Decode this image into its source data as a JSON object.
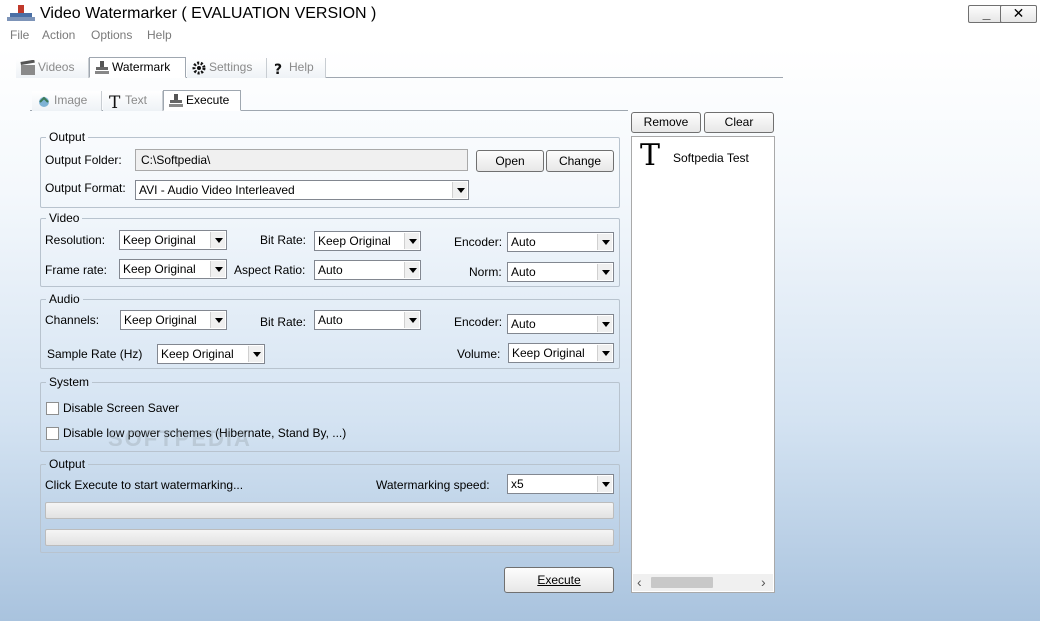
{
  "window": {
    "title": "Video Watermarker ( EVALUATION VERSION )",
    "minimize_glyph": "_",
    "close_glyph": "✕"
  },
  "menu": [
    "File",
    "Action",
    "Options",
    "Help"
  ],
  "main_tabs": [
    {
      "label": "Videos",
      "icon": "film-icon",
      "active": false
    },
    {
      "label": "Watermark",
      "icon": "stamp-icon",
      "active": true
    },
    {
      "label": "Settings",
      "icon": "gear-icon",
      "active": false
    },
    {
      "label": "Help",
      "icon": "help-icon",
      "active": false
    }
  ],
  "sub_tabs": [
    {
      "label": "Image",
      "icon": "image-icon",
      "active": false
    },
    {
      "label": "Text",
      "icon": "text-icon",
      "active": false
    },
    {
      "label": "Execute",
      "icon": "stamp-icon",
      "active": true
    }
  ],
  "output": {
    "legend": "Output",
    "folder_label": "Output Folder:",
    "folder_value": "C:\\Softpedia\\",
    "open_label": "Open",
    "change_label": "Change",
    "format_label": "Output Format:",
    "format_value": "AVI - Audio Video Interleaved"
  },
  "video": {
    "legend": "Video",
    "resolution_label": "Resolution:",
    "resolution_value": "Keep Original",
    "bitrate_label": "Bit Rate:",
    "bitrate_value": "Keep Original",
    "encoder_label": "Encoder:",
    "encoder_value": "Auto",
    "framerate_label": "Frame rate:",
    "framerate_value": "Keep Original",
    "aspect_label": "Aspect Ratio:",
    "aspect_value": "Auto",
    "norm_label": "Norm:",
    "norm_value": "Auto"
  },
  "audio": {
    "legend": "Audio",
    "channels_label": "Channels:",
    "channels_value": "Keep Original",
    "bitrate_label": "Bit Rate:",
    "bitrate_value": "Auto",
    "encoder_label": "Encoder:",
    "encoder_value": "Auto",
    "samplerate_label": "Sample Rate (Hz)",
    "samplerate_value": "Keep Original",
    "volume_label": "Volume:",
    "volume_value": "Keep Original"
  },
  "system": {
    "legend": "System",
    "disable_screensaver": "Disable Screen Saver",
    "disable_lowpower": "Disable low power schemes (Hibernate, Stand By, ...)"
  },
  "progress": {
    "legend": "Output",
    "status": "Click Execute to start watermarking...",
    "speed_label": "Watermarking speed:",
    "speed_value": "x5",
    "bar1": 0,
    "bar2": 0
  },
  "execute_label": "Execute",
  "list": {
    "remove_label": "Remove",
    "clear_label": "Clear",
    "items": [
      {
        "glyph": "T",
        "label": "Softpedia Test"
      }
    ],
    "scroll_left": "‹",
    "scroll_right": "›"
  },
  "ghost_watermark": "SOFTPEDIA"
}
